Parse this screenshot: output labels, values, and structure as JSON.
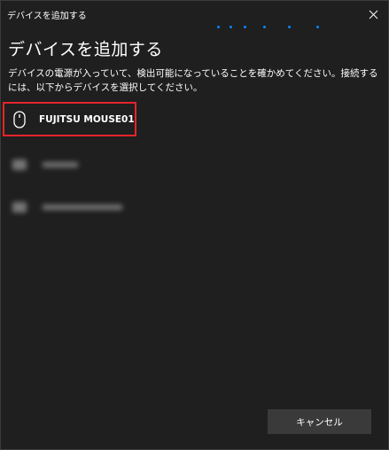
{
  "window": {
    "title": "デバイスを追加する"
  },
  "header": {
    "heading": "デバイスを追加する",
    "instructions": "デバイスの電源が入っていて、検出可能になっていることを確かめてください。接続するには、以下からデバイスを選択してください。"
  },
  "devices": [
    {
      "label": "FUJITSU MOUSE01",
      "icon": "mouse-icon",
      "selected": true
    },
    {
      "label": "",
      "icon": "device-icon",
      "blurred": true
    },
    {
      "label": "",
      "icon": "device-icon",
      "blurred": true
    }
  ],
  "footer": {
    "cancel_label": "キャンセル"
  },
  "colors": {
    "background": "#1f1f1f",
    "highlight": "#e5242b",
    "progress": "#0a84ff",
    "button": "#3a3a3a"
  }
}
